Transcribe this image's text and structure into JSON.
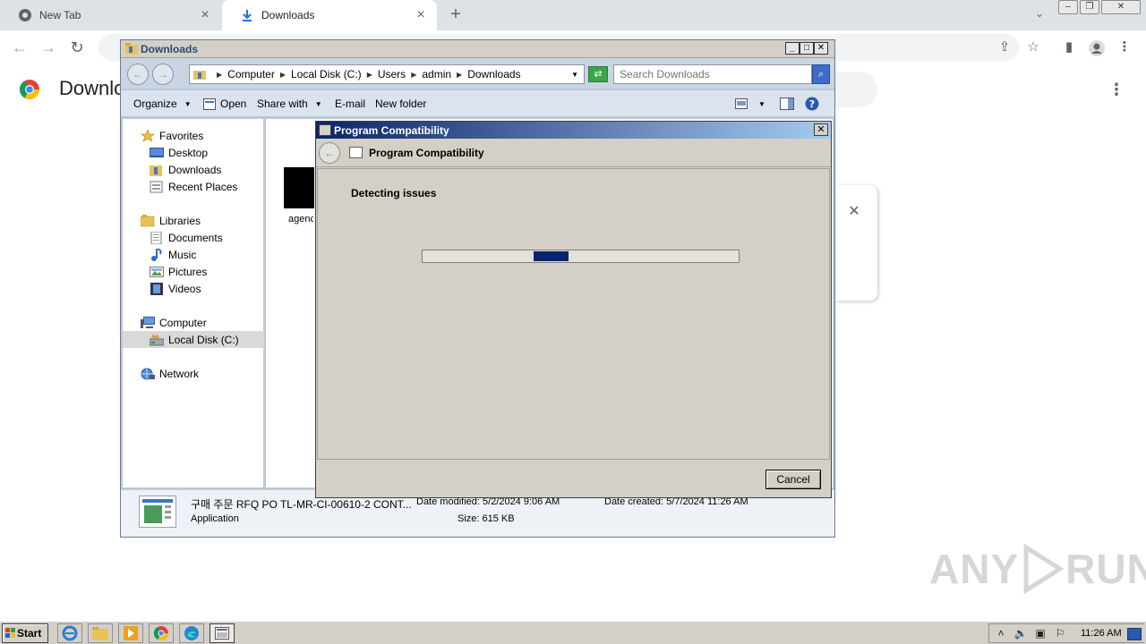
{
  "browser": {
    "tabs": [
      {
        "title": "New Tab",
        "active": false
      },
      {
        "title": "Downloads",
        "active": true
      }
    ],
    "page_title": "Downloads",
    "colors": {
      "tabbar": "#dee1e6",
      "accent": "#1a73e8"
    }
  },
  "explorer": {
    "title": "Downloads",
    "breadcrumb": [
      "Computer",
      "Local Disk (C:)",
      "Users",
      "admin",
      "Downloads"
    ],
    "search_placeholder": "Search Downloads",
    "toolbar": {
      "organize": "Organize",
      "open": "Open",
      "share_with": "Share with",
      "email": "E-mail",
      "new_folder": "New folder"
    },
    "nav": {
      "favorites": {
        "label": "Favorites",
        "items": [
          "Desktop",
          "Downloads",
          "Recent Places"
        ]
      },
      "libraries": {
        "label": "Libraries",
        "items": [
          "Documents",
          "Music",
          "Pictures",
          "Videos"
        ]
      },
      "computer": {
        "label": "Computer",
        "items": [
          "Local Disk (C:)"
        ]
      },
      "network": {
        "label": "Network"
      }
    },
    "file": {
      "label": "agenc"
    },
    "details": {
      "name": "구매 주문 RFQ PO TL-MR-CI-00610-2 CONT...",
      "type": "Application",
      "date_modified": "Date modified: 5/2/2024 9:06 AM",
      "size": "Size: 615 KB",
      "date_created": "Date created: 5/7/2024 11:26 AM"
    }
  },
  "dialog": {
    "title": "Program Compatibility",
    "header": "Program Compatibility",
    "status": "Detecting issues",
    "progress_start": 0.35,
    "progress_end": 0.46,
    "cancel_label": "Cancel"
  },
  "taskbar": {
    "start_label": "Start",
    "clock": "11:26 AM"
  },
  "watermark": {
    "text_left": "ANY",
    "text_right": "RUN"
  }
}
